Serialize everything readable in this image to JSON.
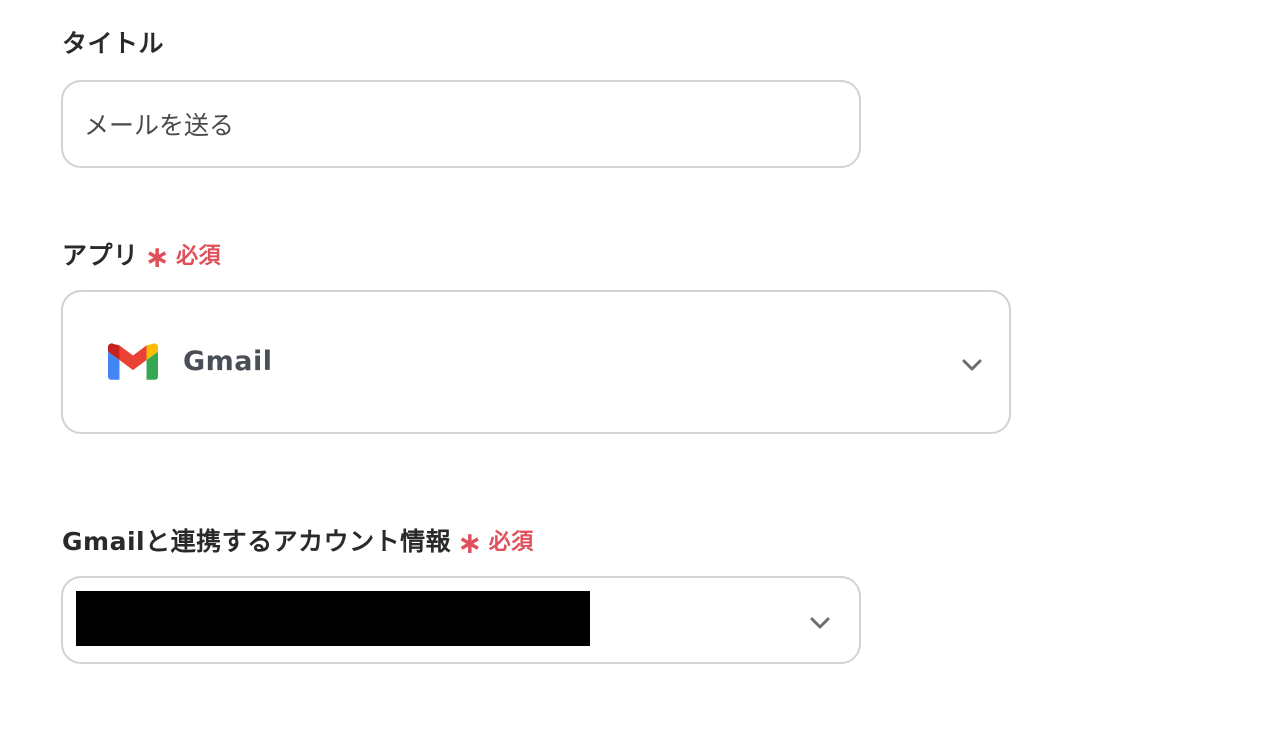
{
  "title_field": {
    "label": "タイトル",
    "value": "メールを送る"
  },
  "app_field": {
    "label": "アプリ",
    "required_star": "∗",
    "required_text": "必須",
    "selected_app": "Gmail",
    "app_icon": "gmail-logo-icon",
    "dropdown_icon": "chevron-down-icon"
  },
  "account_field": {
    "label": "Gmailと連携するアカウント情報",
    "required_star": "∗",
    "required_text": "必須",
    "selected_value": "",
    "dropdown_icon": "chevron-down-icon"
  },
  "colors": {
    "required": "#e0505a",
    "border": "#d2d2d2",
    "text": "#2a2a2a"
  }
}
